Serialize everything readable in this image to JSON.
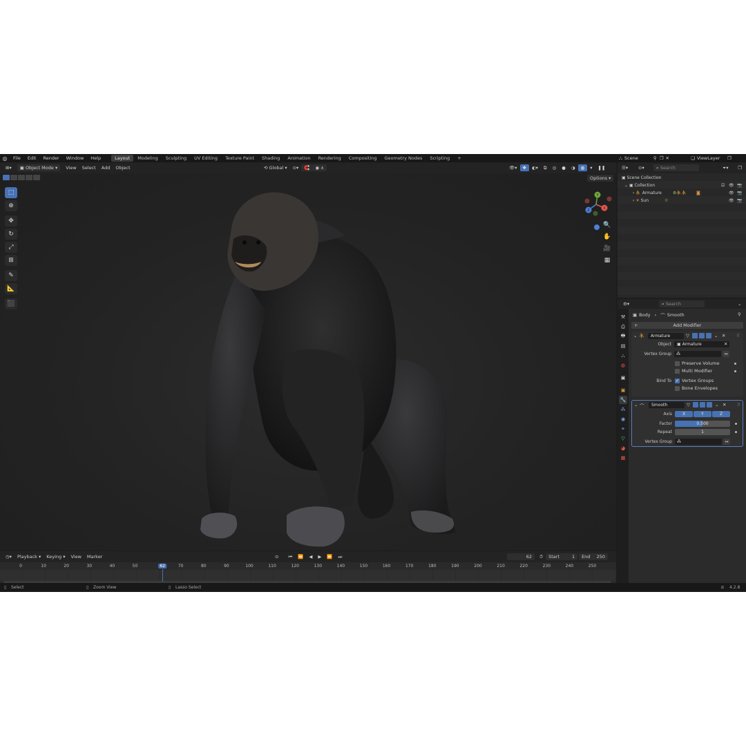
{
  "menu": [
    "File",
    "Edit",
    "Render",
    "Window",
    "Help"
  ],
  "workspaces": [
    "Layout",
    "Modeling",
    "Sculpting",
    "UV Editing",
    "Texture Paint",
    "Shading",
    "Animation",
    "Rendering",
    "Compositing",
    "Geometry Nodes",
    "Scripting"
  ],
  "active_workspace": "Layout",
  "scene": {
    "label": "Scene",
    "view_layer": "ViewLayer"
  },
  "viewport_header": {
    "mode": "Object Mode",
    "menus": [
      "View",
      "Select",
      "Add",
      "Object"
    ],
    "orientation": "Global",
    "options_label": "Options"
  },
  "gizmo": {
    "x": "X",
    "y": "Y",
    "z": "Z"
  },
  "outliner": {
    "search_placeholder": "Search",
    "root": "Scene Collection",
    "collection": "Collection",
    "items": [
      "Armature",
      "Sun"
    ]
  },
  "properties": {
    "search_placeholder": "Search",
    "breadcrumb": [
      "Body",
      "Smooth"
    ],
    "add_modifier": "Add Modifier",
    "armature_mod": {
      "name": "Armature",
      "object_label": "Object",
      "object_value": "Armature",
      "vertex_group_label": "Vertex Group",
      "preserve_volume": "Preserve Volume",
      "multi_modifier": "Multi Modifier",
      "bind_to_label": "Bind To",
      "vertex_groups": "Vertex Groups",
      "bone_envelopes": "Bone Envelopes"
    },
    "smooth_mod": {
      "name": "Smooth",
      "axis_label": "Axis",
      "axis": [
        "X",
        "Y",
        "Z"
      ],
      "factor_label": "Factor",
      "factor_value": "0.500",
      "repeat_label": "Repeat",
      "repeat_value": "1",
      "vertex_group_label": "Vertex Group"
    }
  },
  "timeline": {
    "menus": [
      "Playback",
      "Keying",
      "View",
      "Marker"
    ],
    "current_frame": "62",
    "start_label": "Start",
    "start_value": "1",
    "end_label": "End",
    "end_value": "250",
    "ticks": [
      "0",
      "10",
      "20",
      "30",
      "40",
      "50",
      "62",
      "70",
      "80",
      "90",
      "100",
      "110",
      "120",
      "130",
      "140",
      "150",
      "160",
      "170",
      "180",
      "190",
      "200",
      "210",
      "220",
      "230",
      "240",
      "250"
    ]
  },
  "status": {
    "select": "Select",
    "zoom": "Zoom View",
    "lasso": "Lasso Select",
    "version": "4.2.8"
  },
  "colors": {
    "accent": "#4772b3",
    "axis_x": "#e4584e",
    "axis_y": "#70a53a",
    "axis_z": "#4f7fd6"
  }
}
